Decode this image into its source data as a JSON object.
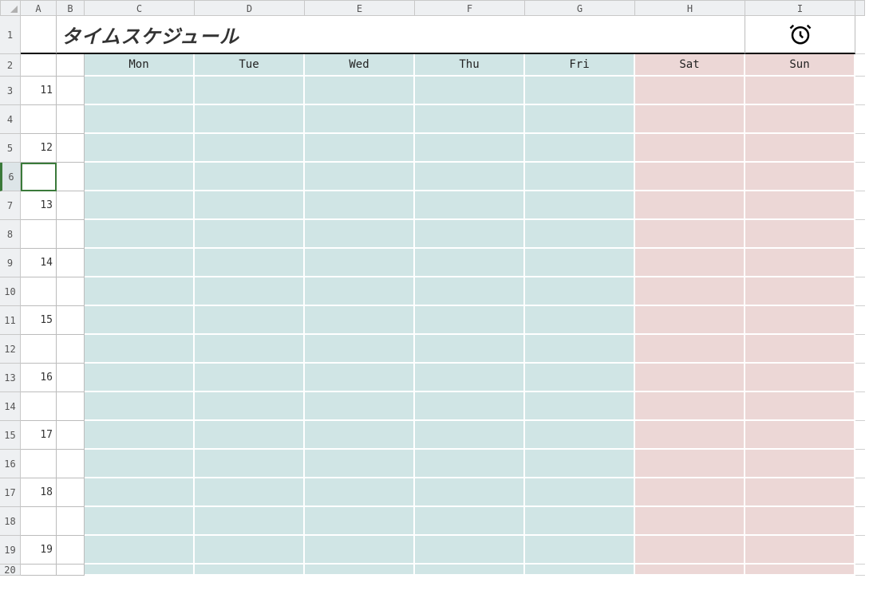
{
  "columns": [
    "A",
    "B",
    "C",
    "D",
    "E",
    "F",
    "G",
    "H",
    "I"
  ],
  "title": "タイムスケジュール",
  "clock_icon_name": "alarm-clock-icon",
  "day_headers": [
    "Mon",
    "Tue",
    "Wed",
    "Thu",
    "Fri",
    "Sat",
    "Sun"
  ],
  "weekday_bg": "#d0e5e5",
  "weekend_bg": "#ecd7d6",
  "row_numbers": [
    1,
    2,
    3,
    4,
    5,
    6,
    7,
    8,
    9,
    10,
    11,
    12,
    13,
    14,
    15,
    16,
    17,
    18,
    19,
    20
  ],
  "hours": {
    "3": "11",
    "5": "12",
    "7": "13",
    "9": "14",
    "11": "15",
    "13": "16",
    "15": "17",
    "17": "18",
    "19": "19"
  },
  "selected_cell": {
    "row": 6,
    "col": "A"
  }
}
